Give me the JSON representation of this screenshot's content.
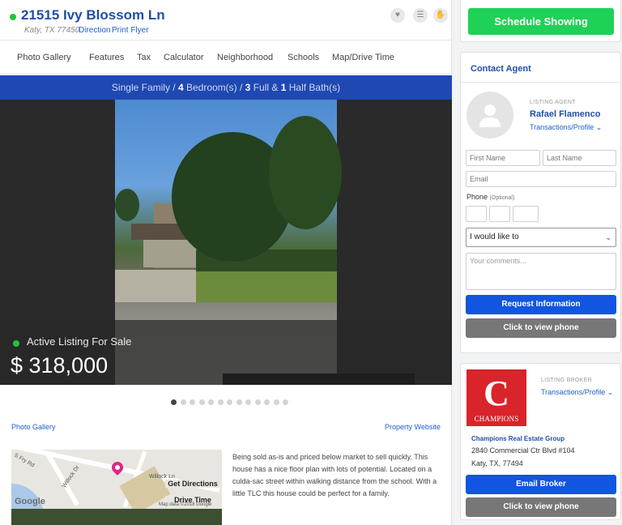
{
  "listing": {
    "address": "21515 Ivy Blossom Ln",
    "city_line": "Katy, TX 77450",
    "direction_link": "Direction",
    "print_flyer_link": "Print Flyer"
  },
  "tabs": [
    "Photo Gallery",
    "Features",
    "Tax",
    "Calculator",
    "Neighborhood",
    "Schools",
    "Map/Drive Time"
  ],
  "banner": {
    "prefix": "Single Family / ",
    "beds": "4",
    "beds_label": " Bedroom(s) / ",
    "full": "3",
    "full_label": " Full & ",
    "half": "1",
    "half_label": " Half Bath(s)"
  },
  "photo": {
    "status": "Active Listing For Sale",
    "price": "$ 318,000",
    "carousel_count": 13,
    "carousel_active": 0
  },
  "links": {
    "photo_gallery": "Photo Gallery",
    "property_website": "Property Website"
  },
  "map": {
    "street_1": "S Fry Rd",
    "street_2": "Willock Dr",
    "street_3": "Willock Ln",
    "google": "Google",
    "get_directions": "Get Directions",
    "drive_time": "Drive Time",
    "attribution": "Map data ©2018 Google"
  },
  "description": "Being sold as-is and priced below market to sell quickly. This house has a nice floor plan with lots of potential. Located on a culda-sac street within walking distance from the school. With a little TLC this house could be perfect for a family.",
  "sidebar": {
    "schedule": "Schedule Showing",
    "contact_title": "Contact Agent",
    "listing_agent_label": "LISTING AGENT",
    "agent_name": "Rafael Flamenco",
    "transactions_profile": "Transactions/Profile",
    "first_name": "First Name",
    "last_name": "Last Name",
    "email": "Email",
    "phone": "Phone",
    "phone_optional": "(Optional)",
    "would_like": "I would like to",
    "comments": "Your comments...",
    "request_info": "Request Information",
    "view_phone": "Click to view phone",
    "listing_broker_label": "LISTING BROKER",
    "broker_logo_letter": "C",
    "broker_logo_text": "CHAMPIONS",
    "broker_name": "Champions Real Estate Group",
    "broker_street": "2840 Commercial Ctr Blvd #104",
    "broker_city": "Katy, TX, 77494",
    "email_broker": "Email Broker",
    "view_phone_2": "Click to view phone"
  },
  "colors": {
    "brand_blue": "#1f4fa8",
    "banner_blue": "#1f48b3",
    "cta_green": "#1fd156",
    "button_blue": "#1155e0",
    "status_green": "#22c33a",
    "broker_red": "#d8242a"
  }
}
